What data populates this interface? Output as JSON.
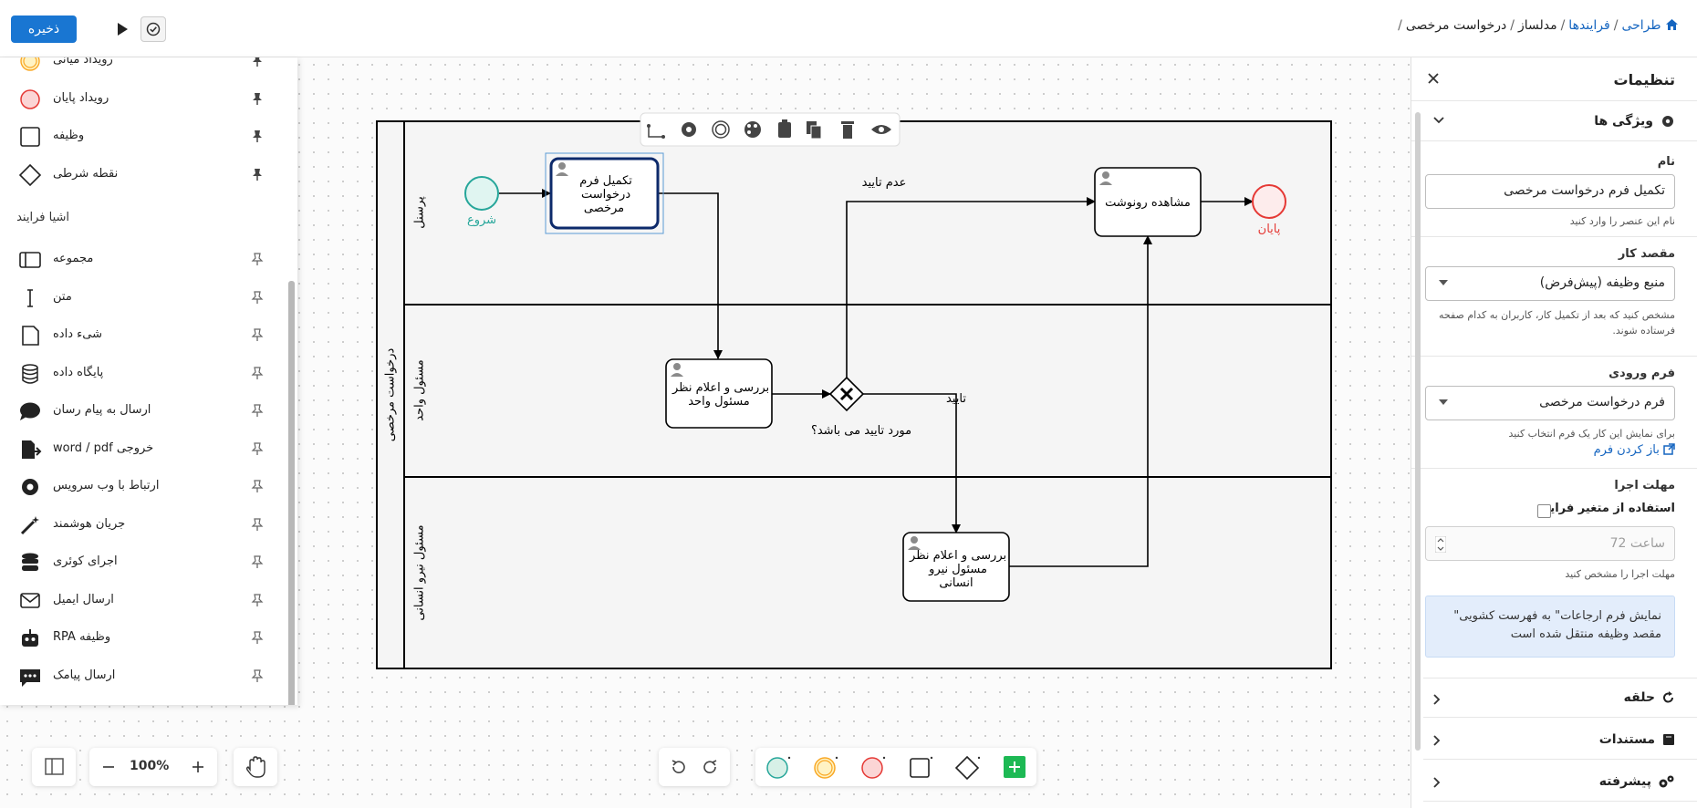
{
  "topbar": {
    "save_label": "ذخیره",
    "breadcrumb": [
      "طراحی",
      "فرایندها",
      "مدلساز",
      "درخواست مرخصی"
    ]
  },
  "palette": {
    "top_items": [
      {
        "label": "رویداد میانی",
        "icon": "intermediate-event-icon"
      },
      {
        "label": "رویداد پایان",
        "icon": "end-event-icon"
      },
      {
        "label": "وظیفه",
        "icon": "task-icon"
      },
      {
        "label": "نقطه شرطی",
        "icon": "gateway-icon"
      }
    ],
    "section_title": "اشیا فرایند",
    "objects": [
      {
        "label": "مجموعه",
        "icon": "group-icon"
      },
      {
        "label": "متن",
        "icon": "text-cursor-icon"
      },
      {
        "label": "شیء داده",
        "icon": "data-object-icon"
      },
      {
        "label": "پایگاه داده",
        "icon": "database-icon"
      },
      {
        "label": "ارسال به پیام رسان",
        "icon": "chat-bubble-icon"
      },
      {
        "label": "خروجی word / pdf",
        "icon": "file-export-icon"
      },
      {
        "label": "ارتباط با وب سرویس",
        "icon": "gear-icon"
      },
      {
        "label": "جریان هوشمند",
        "icon": "magic-wand-icon"
      },
      {
        "label": "اجرای کوئری",
        "icon": "database-stack-icon"
      },
      {
        "label": "ارسال ایمیل",
        "icon": "envelope-icon"
      },
      {
        "label": "وظیفه RPA",
        "icon": "robot-icon"
      },
      {
        "label": "ارسال پیامک",
        "icon": "sms-icon"
      }
    ]
  },
  "diagram": {
    "pool_name": "درخواست مرخصی",
    "lanes": [
      "پرسنل",
      "مسئول واحد",
      "مسئول نیرو انسانی"
    ],
    "start_label": "شروع",
    "end_label": "پایان",
    "tasks": {
      "fill_form": [
        "تکمیل فرم",
        "درخواست",
        "مرخصی"
      ],
      "unit_review": [
        "بررسی و اعلام نظر",
        "مسئول واحد"
      ],
      "hr_review": [
        "بررسی و اعلام نظر",
        "مسئول نیرو",
        "انسانی"
      ],
      "view_copy": [
        "مشاهده رونوشت"
      ]
    },
    "gateway_label": "مورد تایید می باشد؟",
    "flow_reject": "عدم تایید",
    "flow_approve": "تایید"
  },
  "zoom": {
    "value": "100%"
  },
  "settings": {
    "title": "تنظیمات",
    "properties_title": "ویژگی ها",
    "name_label": "نام",
    "name_value": "تکمیل فرم درخواست مرخصی",
    "name_help": "نام این عنصر را وارد کنید",
    "purpose_label": "مقصد کار",
    "purpose_value": "منبع وظیفه (پیش‌فرض)",
    "purpose_help": "مشخص کنید که بعد از تکمیل کار، کاربران به کدام صفحه فرستاده شوند.",
    "form_label": "فرم ورودی",
    "form_value": "فرم درخواست مرخصی",
    "form_help": "برای نمایش این کار یک فرم انتخاب کنید",
    "open_form_link": "باز کردن فرم",
    "deadline_label": "مهلت اجرا",
    "use_variable_label": "استفاده از متغیر فرایند",
    "deadline_placeholder": "ساعت 72",
    "deadline_help": "مهلت اجرا را مشخص کنید",
    "notice": "نمایش فرم ارجاعات\" به فهرست کشویی\" مقصد وظیفه منتقل شده است",
    "sections": [
      "حلقه",
      "مستندات",
      "پیشرفته"
    ]
  },
  "colors": {
    "primary": "#1976d2",
    "start": "#26a69a",
    "end": "#e53935",
    "intermediate": "#f9a825",
    "add": "#1db954"
  }
}
